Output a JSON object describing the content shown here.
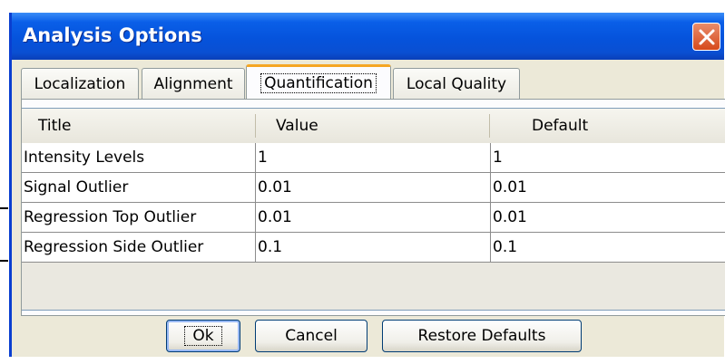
{
  "window": {
    "title": "Analysis Options",
    "close_icon": "close-x-icon",
    "accent": "#0a5fe8",
    "close_color": "#d64a1c"
  },
  "tabs": [
    {
      "label": "Localization",
      "active": false
    },
    {
      "label": "Alignment",
      "active": false
    },
    {
      "label": "Quantification",
      "active": true
    },
    {
      "label": "Local Quality",
      "active": false
    }
  ],
  "table": {
    "columns": [
      "Title",
      "Value",
      "Default"
    ],
    "rows": [
      {
        "title": "Intensity Levels",
        "value": "1",
        "default": "1"
      },
      {
        "title": "Signal Outlier",
        "value": "0.01",
        "default": "0.01"
      },
      {
        "title": "Regression Top Outlier",
        "value": "0.01",
        "default": "0.01"
      },
      {
        "title": "Regression Side Outlier",
        "value": "0.1",
        "default": "0.1"
      }
    ]
  },
  "buttons": {
    "ok": "Ok",
    "cancel": "Cancel",
    "restore": "Restore Defaults"
  }
}
